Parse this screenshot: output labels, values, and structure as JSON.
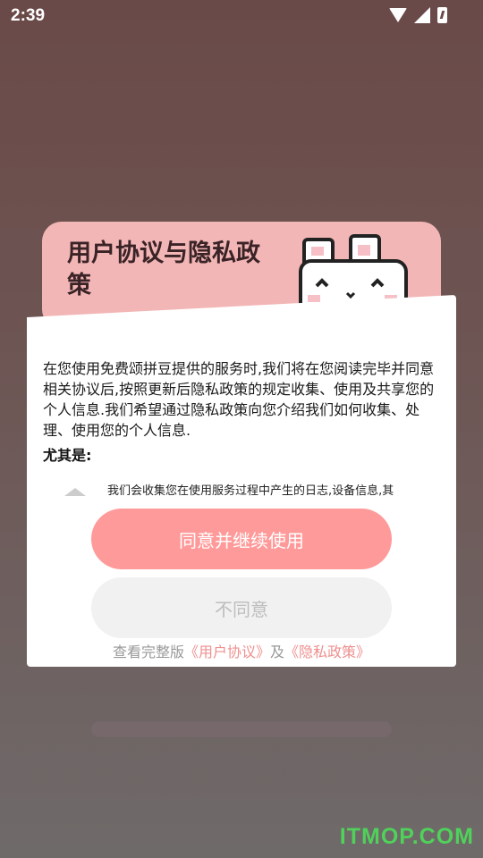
{
  "status_bar": {
    "time": "2:39"
  },
  "header": {
    "title": "用户协议与隐私政策"
  },
  "dialog": {
    "intro": "在您使用免费颂拼豆提供的服务时,我们将在您阅读完毕并同意相关协议后,按照更新后隐私政策的规定收集、使用及共享您的个人信息.我们希望通过隐私政策向您介绍我们如何收集、处理、使用您的个人信息.",
    "subhead": "尤其是:",
    "bullet_1": "我们会收集您在使用服务过程中产生的日志,设备信息,其"
  },
  "buttons": {
    "agree": "同意并继续使用",
    "disagree": "不同意"
  },
  "footer": {
    "prefix": "查看完整版",
    "user_agreement": "《用户协议》",
    "and": "及",
    "privacy_policy": "《隐私政策》"
  },
  "watermark": "ITMOP.COM",
  "colors": {
    "accent": "#ff9a9a",
    "header": "#f3b6b6",
    "link": "#ef8f8f"
  }
}
